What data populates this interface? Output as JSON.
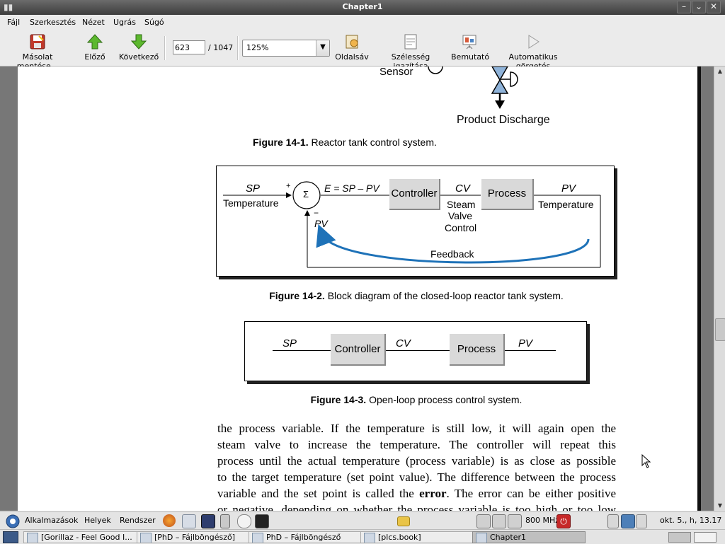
{
  "window": {
    "title": "Chapter1"
  },
  "menu": [
    "Fájl",
    "Szerkesztés",
    "Nézet",
    "Ugrás",
    "Súgó"
  ],
  "toolbar": {
    "save_copy": "Másolat mentése...",
    "prev": "Előző",
    "next": "Következő",
    "page_value": "623",
    "page_total": "/ 1047",
    "zoom_value": "125%",
    "sidebar": "Oldalsáv",
    "fit_width": "Szélesség igazítása",
    "presentation": "Bemutató",
    "autoscroll": "Automatikus görgetés"
  },
  "document": {
    "fig1": {
      "sensor_label": "Sensor",
      "discharge_label": "Product Discharge",
      "caption_num": "Figure 14-1.",
      "caption_text": " Reactor tank control system."
    },
    "fig2": {
      "sp": "SP",
      "temperature_in": "Temperature",
      "plus": "+",
      "minus": "−",
      "sigma": "Σ",
      "error_eq": "E = SP – PV",
      "controller": "Controller",
      "cv": "CV",
      "cv_desc_1": "Steam",
      "cv_desc_2": "Valve",
      "cv_desc_3": "Control",
      "process": "Process",
      "pv_out": "PV",
      "temperature_out": "Temperature",
      "pv_in": "PV",
      "feedback": "Feedback",
      "caption_num": "Figure 14-2.",
      "caption_text": " Block diagram of the closed-loop reactor tank system."
    },
    "fig3": {
      "sp": "SP",
      "controller": "Controller",
      "cv": "CV",
      "process": "Process",
      "pv": "PV",
      "caption_num": "Figure 14-3.",
      "caption_text": " Open-loop process control system."
    },
    "body_lines": [
      "the process variable. If the temperature is still low, it will again open the",
      "steam valve to increase the temperature. The controller will repeat this",
      "process until the actual temperature (process variable) is as close as possible",
      "to the target temperature (set point value). The difference between the process"
    ],
    "body_line5_pre": "variable and the set point is called the ",
    "body_line5_bold": "error",
    "body_line5_post": ". The error can be either positive",
    "body_line6": "or negative, depending on whether the process variable is too high or too low"
  },
  "panel": {
    "applications": "Alkalmazások",
    "places": "Helyek",
    "system": "Rendszer",
    "cpu_freq": "800 MHz",
    "clock": "okt. 5., h, 13.17"
  },
  "taskbar": [
    {
      "label": "[Gorillaz - Feel Good I..."
    },
    {
      "label": "[PhD – Fájlböngésző]"
    },
    {
      "label": "PhD – Fájlböngésző"
    },
    {
      "label": "[plcs.book]"
    },
    {
      "label": "Chapter1"
    }
  ],
  "colors": {
    "feedback_arrow": "#1e72b8",
    "valve_blue": "#8fb3d9"
  }
}
